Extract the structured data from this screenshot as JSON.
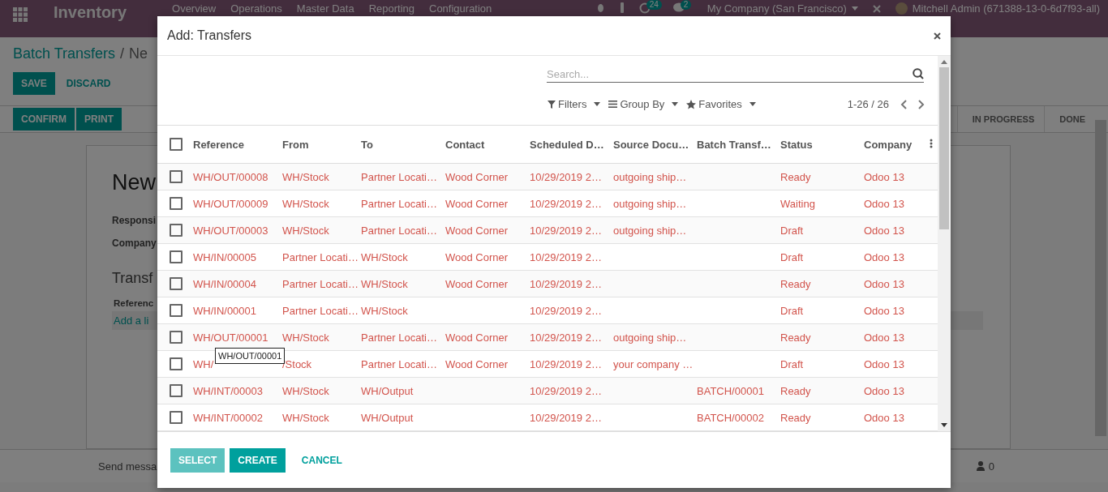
{
  "navbar": {
    "app": "Inventory",
    "menus": [
      "Overview",
      "Operations",
      "Master Data",
      "Reporting",
      "Configuration"
    ],
    "activity_count": "24",
    "message_count": "2",
    "company": "My Company (San Francisco)",
    "user": "Mitchell Admin (671388-13-0-6d7f93-all)"
  },
  "page": {
    "breadcrumb": "Batch Transfers",
    "separator": "/",
    "breadcrumb_current": "Ne",
    "buttons": [
      {
        "label": "SAVE",
        "kind": "primary"
      },
      {
        "label": "DISCARD",
        "kind": "link"
      }
    ],
    "actions": [
      "CONFIRM",
      "PRINT"
    ],
    "stages": [
      {
        "label": "IN PROGRESS",
        "selected": false
      },
      {
        "label": "DONE",
        "selected": false
      }
    ],
    "form": {
      "title": "New",
      "fields": [
        "Responsi",
        "Company"
      ],
      "section": "Transf",
      "column": "Referenc",
      "add_line": "Add a li"
    },
    "chatter": {
      "send": "Send messa",
      "followers": "0"
    }
  },
  "dialog": {
    "title": "Add: Transfers",
    "search": {
      "placeholder": "Search..."
    },
    "filters": [
      "Filters",
      "Group By",
      "Favorites"
    ],
    "pager": "1-26 / 26",
    "header_checkbox": {
      "checked": false
    },
    "columns": [
      "Reference",
      "From",
      "To",
      "Contact",
      "Scheduled D…",
      "Source Docu…",
      "Batch Transf…",
      "Status",
      "Company"
    ],
    "rows": [
      {
        "checked": false,
        "cells": [
          "WH/OUT/00008",
          "WH/Stock",
          "Partner Locati…",
          "Wood Corner",
          "10/29/2019 2…",
          "outgoing ship…",
          null,
          "Ready",
          "Odoo 13"
        ]
      },
      {
        "checked": false,
        "cells": [
          "WH/OUT/00009",
          "WH/Stock",
          "Partner Locati…",
          "Wood Corner",
          "10/29/2019 2…",
          "outgoing ship…",
          null,
          "Waiting",
          "Odoo 13"
        ]
      },
      {
        "checked": false,
        "cells": [
          "WH/OUT/00003",
          "WH/Stock",
          "Partner Locati…",
          "Wood Corner",
          "10/29/2019 2…",
          "outgoing ship…",
          null,
          "Draft",
          "Odoo 13"
        ]
      },
      {
        "checked": false,
        "cells": [
          "WH/IN/00005",
          "Partner Locati…",
          "WH/Stock",
          "Wood Corner",
          "10/29/2019 2…",
          null,
          null,
          "Draft",
          "Odoo 13"
        ]
      },
      {
        "checked": false,
        "cells": [
          "WH/IN/00004",
          "Partner Locati…",
          "WH/Stock",
          "Wood Corner",
          "10/29/2019 2…",
          null,
          null,
          "Ready",
          "Odoo 13"
        ]
      },
      {
        "checked": false,
        "cells": [
          "WH/IN/00001",
          "Partner Locati…",
          "WH/Stock",
          null,
          "10/29/2019 2…",
          null,
          null,
          "Draft",
          "Odoo 13"
        ]
      },
      {
        "checked": false,
        "cells": [
          "WH/OUT/00001",
          "WH/Stock",
          "Partner Locati…",
          "Wood Corner",
          "10/29/2019 2…",
          "outgoing ship…",
          null,
          "Ready",
          "Odoo 13"
        ]
      },
      {
        "checked": false,
        "cells": [
          "WH/",
          "/Stock",
          "Partner Locati…",
          "Wood Corner",
          "10/29/2019 2…",
          "your company …",
          null,
          "Draft",
          "Odoo 13"
        ]
      },
      {
        "checked": false,
        "cells": [
          "WH/INT/00003",
          "WH/Stock",
          "WH/Output",
          null,
          "10/29/2019 2…",
          null,
          "BATCH/00001",
          "Ready",
          "Odoo 13"
        ]
      },
      {
        "checked": false,
        "cells": [
          "WH/INT/00002",
          "WH/Stock",
          "WH/Output",
          null,
          "10/29/2019 2…",
          null,
          "BATCH/00002",
          "Ready",
          "Odoo 13"
        ]
      }
    ],
    "tooltip": "WH/OUT/00001",
    "buttons": [
      {
        "label": "SELECT",
        "kind": "primary",
        "disabled": true
      },
      {
        "label": "CREATE",
        "kind": "primary",
        "disabled": false
      },
      {
        "label": "CANCEL",
        "kind": "link",
        "disabled": false
      }
    ]
  }
}
